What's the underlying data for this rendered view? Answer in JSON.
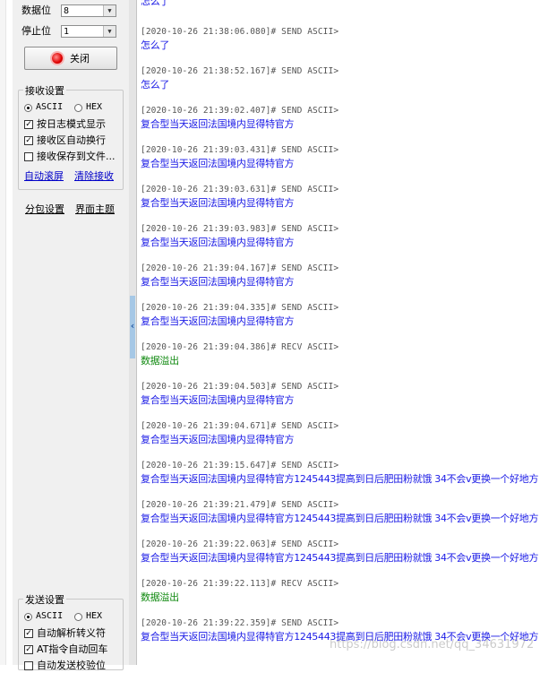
{
  "serial": {
    "data_bits_label": "数据位",
    "data_bits_value": "8",
    "stop_bits_label": "停止位",
    "stop_bits_value": "1",
    "close_label": "关闭"
  },
  "receive_settings": {
    "title": "接收设置",
    "ascii": "ASCII",
    "hex": "HEX",
    "log_mode": "按日志模式显示",
    "auto_wrap": "接收区自动换行",
    "save_to_file": "接收保存到文件...",
    "auto_clear": "自动滚屏",
    "clear_receive": "清除接收"
  },
  "extra_links": {
    "packet_settings": "分包设置",
    "theme": "界面主题"
  },
  "send_settings": {
    "title": "发送设置",
    "ascii": "ASCII",
    "hex": "HEX",
    "auto_escape": "自动解析转义符",
    "at_auto_return": "AT指令自动回车",
    "auto_checksum": "自动发送校验位"
  },
  "log": [
    {
      "ts": "",
      "msg": "怎么了",
      "type": "send"
    },
    {
      "ts": "[2020-10-26 21:38:06.080]# SEND ASCII>",
      "msg": "怎么了",
      "type": "send"
    },
    {
      "ts": "[2020-10-26 21:38:52.167]# SEND ASCII>",
      "msg": "怎么了",
      "type": "send"
    },
    {
      "ts": "[2020-10-26 21:39:02.407]# SEND ASCII>",
      "msg": "复合型当天返回法国境内显得特官方",
      "type": "send"
    },
    {
      "ts": "[2020-10-26 21:39:03.431]# SEND ASCII>",
      "msg": "复合型当天返回法国境内显得特官方",
      "type": "send"
    },
    {
      "ts": "[2020-10-26 21:39:03.631]# SEND ASCII>",
      "msg": "复合型当天返回法国境内显得特官方",
      "type": "send"
    },
    {
      "ts": "[2020-10-26 21:39:03.983]# SEND ASCII>",
      "msg": "复合型当天返回法国境内显得特官方",
      "type": "send"
    },
    {
      "ts": "[2020-10-26 21:39:04.167]# SEND ASCII>",
      "msg": "复合型当天返回法国境内显得特官方",
      "type": "send"
    },
    {
      "ts": "[2020-10-26 21:39:04.335]# SEND ASCII>",
      "msg": "复合型当天返回法国境内显得特官方",
      "type": "send"
    },
    {
      "ts": "[2020-10-26 21:39:04.386]# RECV ASCII>",
      "msg": "数据溢出",
      "type": "recv"
    },
    {
      "ts": "[2020-10-26 21:39:04.503]# SEND ASCII>",
      "msg": "复合型当天返回法国境内显得特官方",
      "type": "send"
    },
    {
      "ts": "[2020-10-26 21:39:04.671]# SEND ASCII>",
      "msg": "复合型当天返回法国境内显得特官方",
      "type": "send"
    },
    {
      "ts": "[2020-10-26 21:39:15.647]# SEND ASCII>",
      "msg": "复合型当天返回法国境内显得特官方1245443提高到日后肥田粉就饿 34不会v更换一个好地方",
      "type": "send"
    },
    {
      "ts": "[2020-10-26 21:39:21.479]# SEND ASCII>",
      "msg": "复合型当天返回法国境内显得特官方1245443提高到日后肥田粉就饿 34不会v更换一个好地方",
      "type": "send"
    },
    {
      "ts": "[2020-10-26 21:39:22.063]# SEND ASCII>",
      "msg": "复合型当天返回法国境内显得特官方1245443提高到日后肥田粉就饿 34不会v更换一个好地方",
      "type": "send"
    },
    {
      "ts": "[2020-10-26 21:39:22.113]# RECV ASCII>",
      "msg": "数据溢出",
      "type": "recv"
    },
    {
      "ts": "[2020-10-26 21:39:22.359]# SEND ASCII>",
      "msg": "复合型当天返回法国境内显得特官方1245443提高到日后肥田粉就饿 34不会v更换一个好地方",
      "type": "send"
    }
  ],
  "watermark": "https://blog.csdn.net/qq_34631972"
}
